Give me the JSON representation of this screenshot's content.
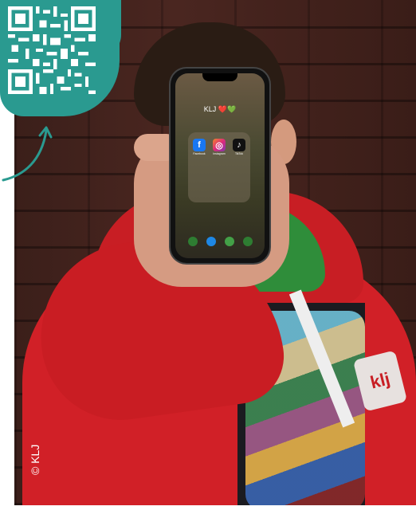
{
  "phone": {
    "title": "KLJ",
    "title_hearts": "❤️💚",
    "folder_apps": [
      {
        "label": "Facebook",
        "icon": "facebook-icon",
        "color": "#1877f2",
        "glyph": "f"
      },
      {
        "label": "Instagram",
        "icon": "instagram-icon",
        "color": "#c13584",
        "glyph": "◎"
      },
      {
        "label": "TikTok",
        "icon": "tiktok-icon",
        "color": "#111111",
        "glyph": "♪"
      }
    ],
    "dock_colors": [
      "#2e7d32",
      "#1e88e5",
      "#43a047",
      "#2e7d32"
    ]
  },
  "badge": {
    "text": "klj"
  },
  "credit": {
    "text": "© KLJ"
  },
  "colors": {
    "accent": "#2a9a90",
    "jacket": "#d12027"
  }
}
